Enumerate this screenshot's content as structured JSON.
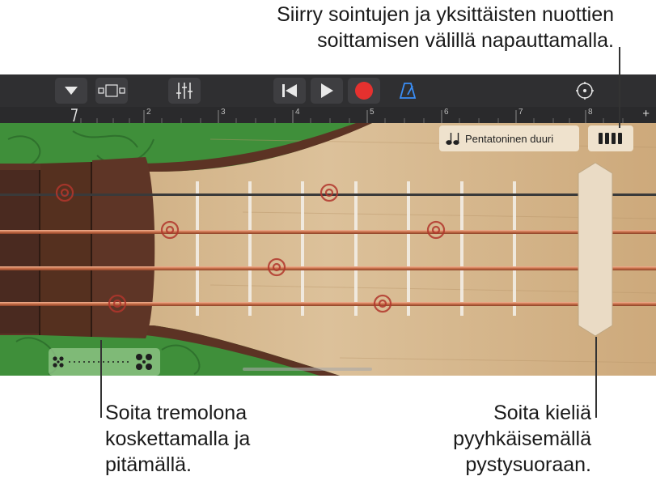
{
  "callouts": {
    "top": [
      "Siirry sointujen ja yksittäisten nuottien",
      "soittamisen välillä napauttamalla."
    ],
    "bottom_left": [
      "Soita tremolona",
      "koskettamalla ja",
      "pitämällä."
    ],
    "bottom_right": [
      "Soita kieliä",
      "pyyhkäisemällä",
      "pystysuoraan."
    ]
  },
  "toolbar": {
    "icons": [
      "browser-menu-icon",
      "view-toggle-icon",
      "mixer-icon",
      "rewind-icon",
      "play-icon",
      "record-icon",
      "metronome-icon",
      "settings-icon"
    ],
    "record_color": "#e5312f",
    "metronome_color": "#3a8ef6"
  },
  "ruler": {
    "bars": [
      "2",
      "3",
      "4",
      "5",
      "6",
      "7",
      "8"
    ],
    "add_label": "+"
  },
  "instrument": {
    "scale_label": "Pentatoninen duuri",
    "scale_icon": "music-notes-icon",
    "mode_icon": "chord-strips-icon",
    "tremolo_icon": "tremolo-fan-icon",
    "string_color": "#d17b5a",
    "wood_color": "#d2b48c",
    "foliage_color": "#3f8f3a"
  }
}
